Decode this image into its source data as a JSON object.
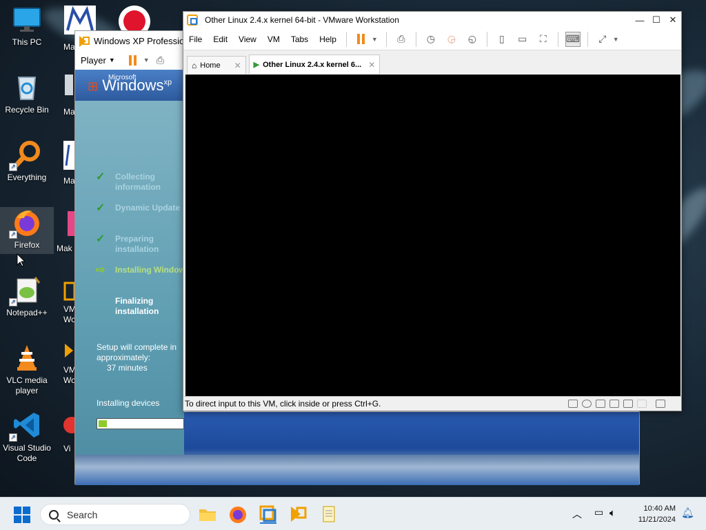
{
  "desktop": {
    "icons": [
      {
        "label": "This PC"
      },
      {
        "label": "Recycle Bin"
      },
      {
        "label": "Everything"
      },
      {
        "label": "Firefox"
      },
      {
        "label": "Notepad++"
      },
      {
        "label": "VLC media player"
      },
      {
        "label": "Visual Studio Code"
      }
    ],
    "second_column": [
      {
        "label": "Maku"
      },
      {
        "label": "Mak"
      },
      {
        "label": "Mak"
      },
      {
        "label": "Mak"
      },
      {
        "label": "VM Wor"
      },
      {
        "label": "VM Wor"
      },
      {
        "label": "Vi"
      }
    ]
  },
  "player_window": {
    "title": "Windows XP Professional",
    "menu_label": "Player",
    "xp_setup": {
      "logo_small": "Microsoft",
      "logo_text": "Windows",
      "logo_sup": "xp",
      "steps": [
        {
          "text": "Collecting information",
          "state": "done"
        },
        {
          "text": "Dynamic Update",
          "state": "done"
        },
        {
          "text": "Preparing installation",
          "state": "done"
        },
        {
          "text": "Installing Windows",
          "state": "current"
        },
        {
          "text": "Finalizing installation",
          "state": "pending"
        }
      ],
      "eta_line1": "Setup will complete in",
      "eta_line2": "approximately:",
      "eta_minutes": "37 minutes",
      "progress_label": "Installing devices",
      "progress": 0.1
    }
  },
  "vmware_window": {
    "title": "Other Linux 2.4.x kernel 64-bit - VMware Workstation",
    "menu": [
      "File",
      "Edit",
      "View",
      "VM",
      "Tabs",
      "Help"
    ],
    "tabs": [
      {
        "label": "Home",
        "icon": "home-icon",
        "active": false
      },
      {
        "label": "Other Linux 2.4.x kernel 6...",
        "icon": "vm-icon",
        "active": true
      }
    ],
    "status_text": "To direct input to this VM, click inside or press Ctrl+G."
  },
  "taskbar": {
    "search_placeholder": "Search",
    "time": "10:40 AM",
    "date": "11/21/2024"
  },
  "colors": {
    "accent": "#0a6cce",
    "vm_pause": "#f08c1c",
    "xp_check": "#2e9b2e",
    "xp_progress": "#8fca2b"
  }
}
